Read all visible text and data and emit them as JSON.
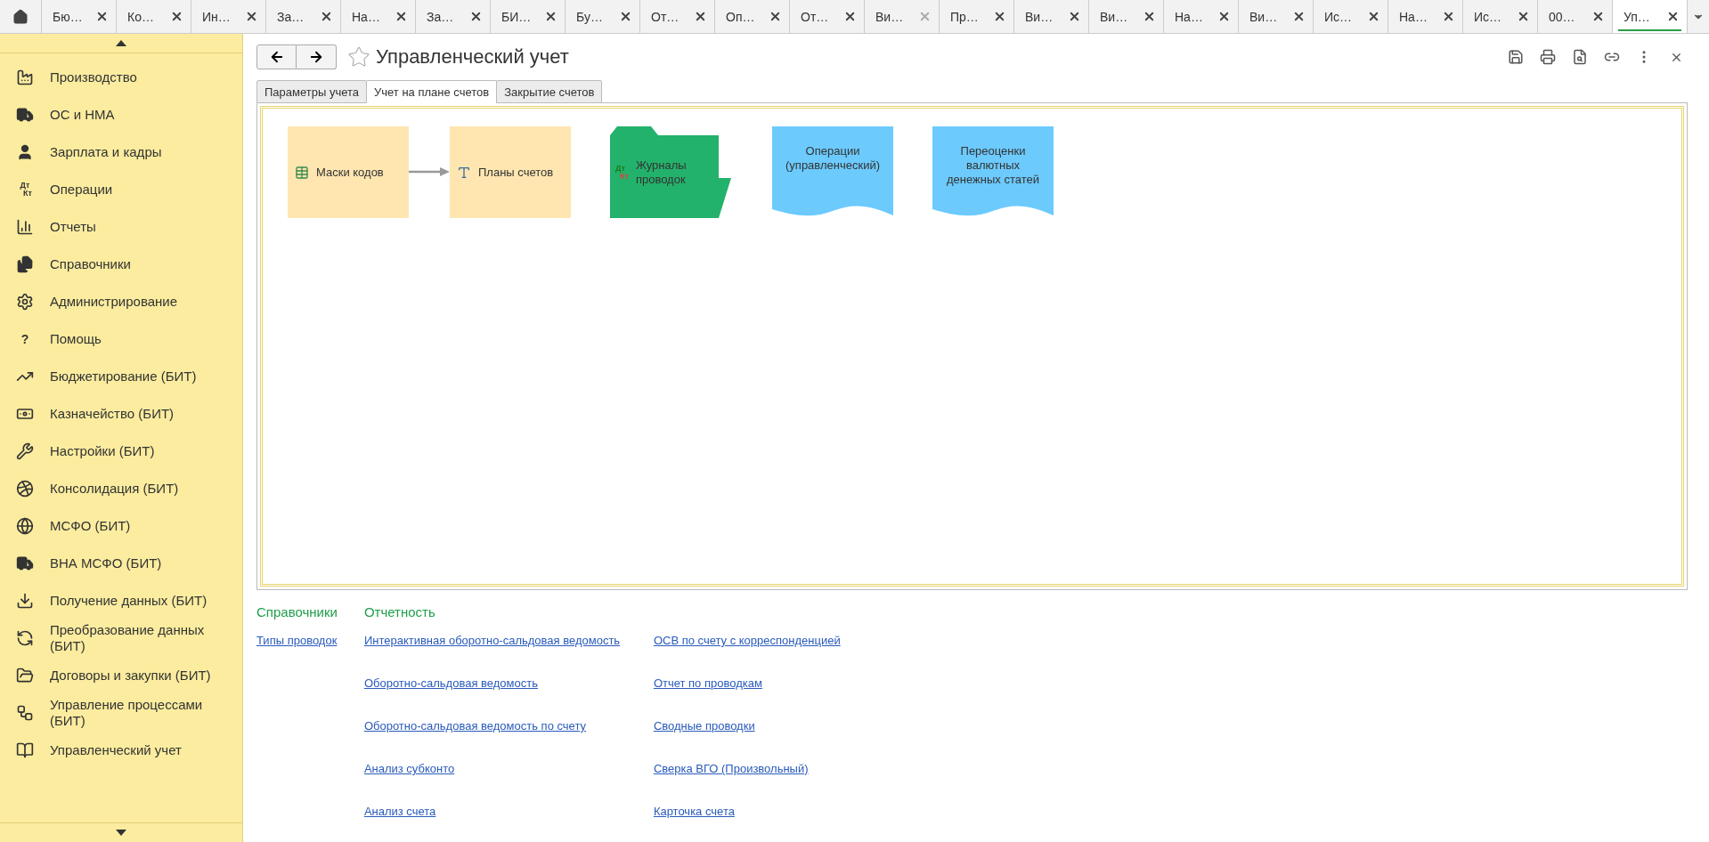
{
  "tabs": [
    {
      "label": "Бю…",
      "selected": false,
      "close_disabled": false
    },
    {
      "label": "Ко…",
      "selected": false,
      "close_disabled": false
    },
    {
      "label": "Ин…",
      "selected": false,
      "close_disabled": false
    },
    {
      "label": "За…",
      "selected": false,
      "close_disabled": false
    },
    {
      "label": "На…",
      "selected": false,
      "close_disabled": false
    },
    {
      "label": "За…",
      "selected": false,
      "close_disabled": false
    },
    {
      "label": "БИ…",
      "selected": false,
      "close_disabled": false
    },
    {
      "label": "Бу…",
      "selected": false,
      "close_disabled": false
    },
    {
      "label": "От…",
      "selected": false,
      "close_disabled": false
    },
    {
      "label": "Оп…",
      "selected": false,
      "close_disabled": false
    },
    {
      "label": "От…",
      "selected": false,
      "close_disabled": false
    },
    {
      "label": "Ви…",
      "selected": false,
      "close_disabled": true
    },
    {
      "label": "Пр…",
      "selected": false,
      "close_disabled": false
    },
    {
      "label": "Ви…",
      "selected": false,
      "close_disabled": false
    },
    {
      "label": "Ви…",
      "selected": false,
      "close_disabled": false
    },
    {
      "label": "На…",
      "selected": false,
      "close_disabled": false
    },
    {
      "label": "Ви…",
      "selected": false,
      "close_disabled": false
    },
    {
      "label": "Ис…",
      "selected": false,
      "close_disabled": false
    },
    {
      "label": "На…",
      "selected": false,
      "close_disabled": false
    },
    {
      "label": "Ис…",
      "selected": false,
      "close_disabled": false
    },
    {
      "label": "00…",
      "selected": false,
      "close_disabled": false
    },
    {
      "label": "Уп…",
      "selected": true,
      "close_disabled": false
    }
  ],
  "sidebar": {
    "items": [
      {
        "label": "Производство"
      },
      {
        "label": "ОС и НМА"
      },
      {
        "label": "Зарплата и кадры"
      },
      {
        "label": "Операции",
        "icon_text": [
          "Дт",
          "Кт"
        ]
      },
      {
        "label": "Отчеты"
      },
      {
        "label": "Справочники"
      },
      {
        "label": "Администрирование"
      },
      {
        "label": "Помощь",
        "icon_text": [
          "?"
        ]
      },
      {
        "label": "Бюджетирование (БИТ)"
      },
      {
        "label": "Казначейство (БИТ)"
      },
      {
        "label": "Настройки (БИТ)"
      },
      {
        "label": "Консолидация (БИТ)"
      },
      {
        "label": "МСФО (БИТ)"
      },
      {
        "label": "ВНА МСФО (БИТ)"
      },
      {
        "label": "Получение данных (БИТ)"
      },
      {
        "label": "Преобразование данных (БИТ)"
      },
      {
        "label": "Договоры и закупки (БИТ)"
      },
      {
        "label": "Управление процессами (БИТ)"
      },
      {
        "label": "Управленческий учет"
      }
    ]
  },
  "form": {
    "title": "Управленческий учет",
    "favorite": false,
    "tabs": [
      {
        "label": "Параметры учета",
        "selected": false
      },
      {
        "label": "Учет на плане счетов",
        "selected": true
      },
      {
        "label": "Закрытие счетов",
        "selected": false
      }
    ],
    "diagram": {
      "nodes": [
        {
          "label": "Маски кодов",
          "kind": "catalog"
        },
        {
          "label": "Планы счетов",
          "kind": "catalog"
        },
        {
          "label": "Журналы проводок",
          "kind": "journal",
          "icon_text": [
            "Дт",
            "Кт"
          ]
        },
        {
          "label": "Операции (управленческий)",
          "kind": "document"
        },
        {
          "label": "Переоценки валютных денежных статей",
          "kind": "document"
        }
      ]
    },
    "sections": [
      {
        "heading": "Справочники",
        "columns": [
          [
            "Типы проводок"
          ]
        ]
      },
      {
        "heading": "Отчетность",
        "columns": [
          [
            "Интерактивная оборотно-сальдовая ведомость",
            "Оборотно-сальдовая ведомость",
            "Оборотно-сальдовая ведомость по счету",
            "Анализ субконто",
            "Анализ счета"
          ],
          [
            "ОСВ по счету с корреспонденцией",
            "Отчет по проводкам",
            "Сводные проводки",
            "Сверка ВГО (Произвольный)",
            "Карточка счета"
          ]
        ]
      }
    ]
  }
}
